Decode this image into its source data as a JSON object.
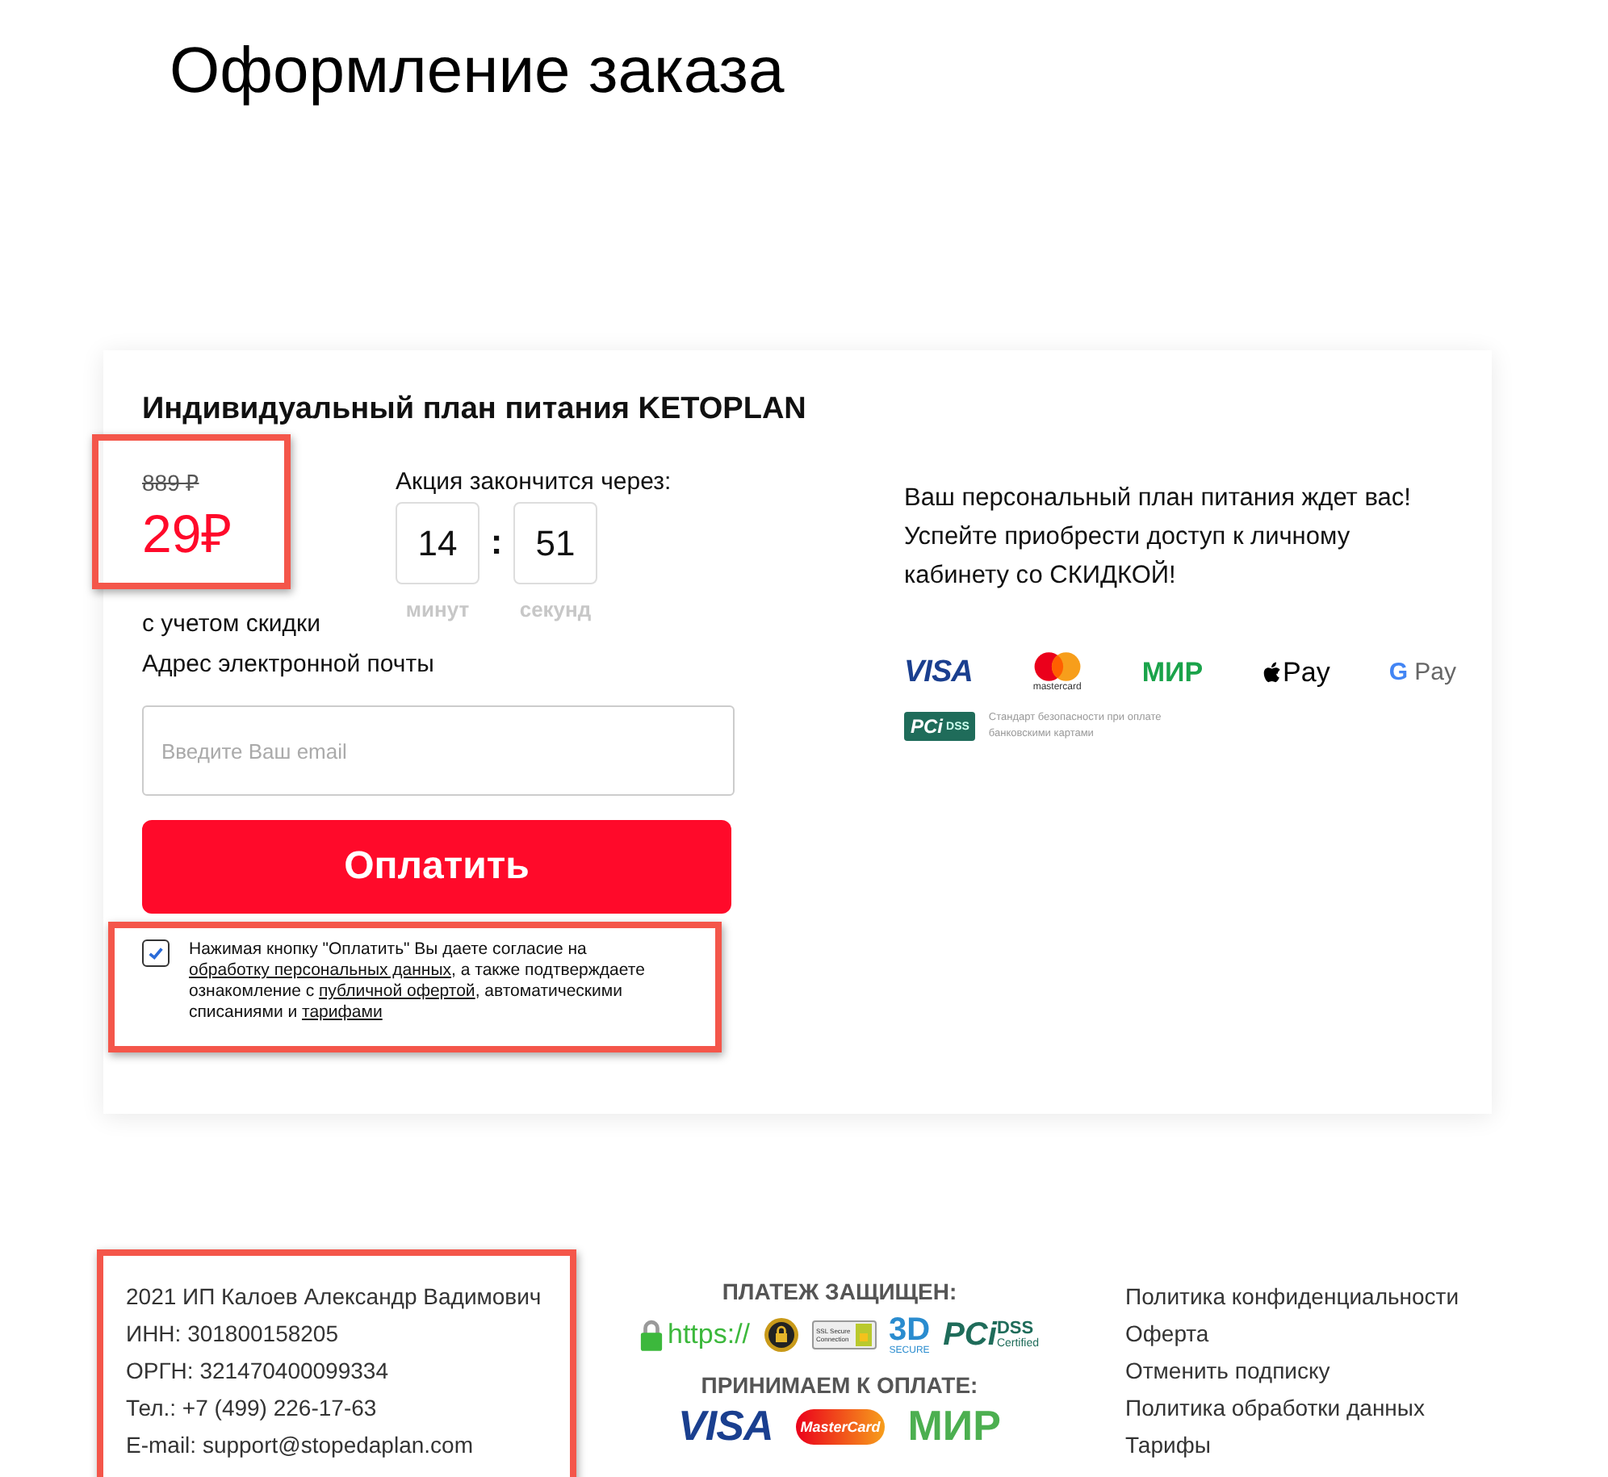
{
  "page_title": "Оформление заказа",
  "product": {
    "title": "Индивидуальный план питания KETOPLAN",
    "old_price": "889 ₽",
    "price": "29₽",
    "price_note": "с учетом скидки"
  },
  "timer": {
    "label": "Акция закончится через:",
    "separator": ":",
    "units": [
      {
        "value": "14",
        "label": "минут"
      },
      {
        "value": "51",
        "label": "секунд"
      }
    ]
  },
  "email": {
    "label": "Адрес электронной почты",
    "placeholder": "Введите Ваш email"
  },
  "pay_button": "Оплатить",
  "consent": {
    "checked": true,
    "parts": [
      {
        "text": "Нажимая кнопку \"Оплатить\" Вы даете согласие на ",
        "link": false
      },
      {
        "text": "обработку персональных данных",
        "link": true
      },
      {
        "text": ", а также подтверждаете ознакомление с ",
        "link": false
      },
      {
        "text": "публичной офертой",
        "link": true
      },
      {
        "text": ", автоматическими списаниями и ",
        "link": false
      },
      {
        "text": "тарифами",
        "link": true
      }
    ]
  },
  "promo_lines": [
    "Ваш персональный план питания ждет вас!",
    "Успейте приобрести доступ к личному",
    "кабинету со СКИДКОЙ!"
  ],
  "payment_methods": [
    {
      "kind": "visa",
      "label": "VISA"
    },
    {
      "kind": "mastercard",
      "label": "mastercard"
    },
    {
      "kind": "mir",
      "label": "МИР"
    },
    {
      "kind": "applepay",
      "label": "Pay"
    },
    {
      "kind": "gpay",
      "mark": "G",
      "label": "Pay"
    }
  ],
  "pci": {
    "logo": "PCi",
    "sub": "DSS",
    "note": "Стандарт безопасности при оплате банковскими картами"
  },
  "footer": {
    "company_lines": [
      "2021 ИП Калоев Александр Вадимович",
      "ИНН: 301800158205",
      "ОРГН: 321470400099334",
      "Тел.: +7 (499) 226-17-63",
      "E-mail: support@stopedaplan.com"
    ],
    "secure_title": "ПЛАТЕЖ ЗАЩИЩЕН:",
    "secure_badges": [
      {
        "kind": "https",
        "label": "https://"
      },
      {
        "kind": "seal"
      },
      {
        "kind": "ssl",
        "label": "SSL Secure Connection"
      },
      {
        "kind": "threed",
        "label": "3D",
        "sub": "SECURE"
      },
      {
        "kind": "pci",
        "label": "PCi",
        "sub": "DSS",
        "note": "Certified"
      }
    ],
    "accept_title": "ПРИНИМАЕМ К ОПЛАТЕ:",
    "accept_logos": [
      {
        "kind": "visa",
        "label": "VISA"
      },
      {
        "kind": "mastercard",
        "label": "MasterCard"
      },
      {
        "kind": "mir",
        "label": "МИР"
      }
    ],
    "links": [
      "Политика конфиденциальности",
      "Оферта",
      "Отменить подписку",
      "Политика обработки данных",
      "Тарифы"
    ]
  }
}
